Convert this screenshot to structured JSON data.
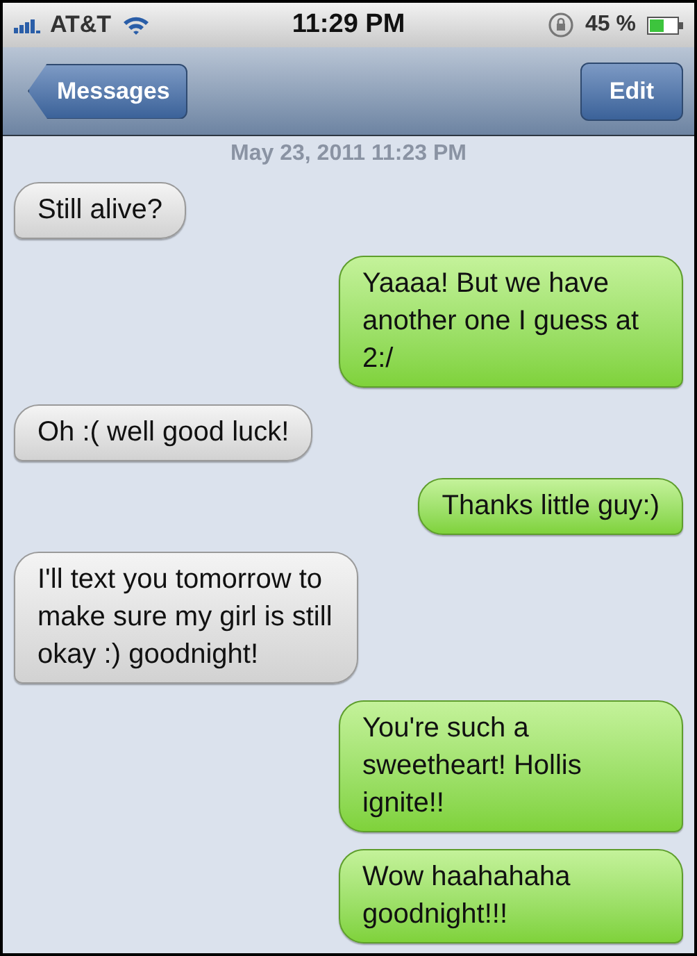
{
  "status_bar": {
    "carrier": "AT&T",
    "time": "11:29 PM",
    "battery": "45 %"
  },
  "nav_bar": {
    "back": "Messages",
    "edit": "Edit"
  },
  "timestamp": "May 23, 2011 11:23 PM",
  "messages": [
    {
      "text": "Still alive?",
      "kind": "received"
    },
    {
      "text": "Yaaaa! But we have another one I guess at 2:/",
      "kind": "sent"
    },
    {
      "text": "Oh :( well good luck!",
      "kind": "received"
    },
    {
      "text": "Thanks little guy:)",
      "kind": "sent"
    },
    {
      "text": "I'll text you tomorrow to make sure my girl is still okay :) goodnight!",
      "kind": "received"
    },
    {
      "text": "You're such a sweetheart! Hollis ignite!!",
      "kind": "sent"
    },
    {
      "text": "Wow haahahaha goodnight!!!",
      "kind": "sent"
    }
  ]
}
